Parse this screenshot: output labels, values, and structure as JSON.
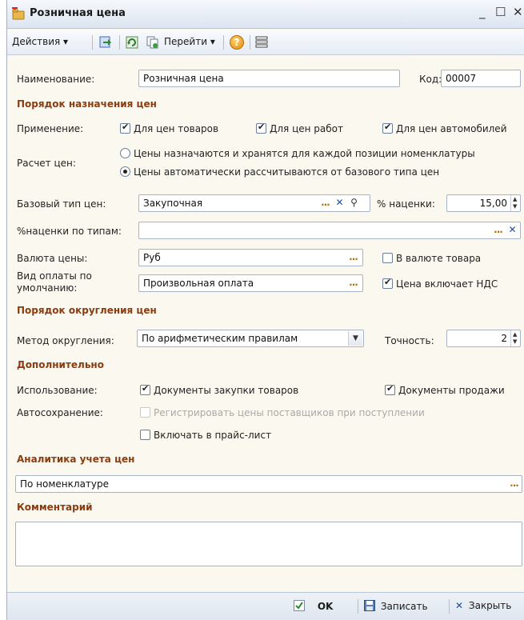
{
  "window": {
    "title": "Розничная цена",
    "minimize": "_",
    "maximize": "☐",
    "close": "✕"
  },
  "toolbar": {
    "actions": "Действия",
    "goto": "Перейти",
    "help": "?"
  },
  "form": {
    "name_label": "Наименование:",
    "name_value": "Розничная цена",
    "code_label": "Код:",
    "code_value": "00007",
    "section_assign": "Порядок назначения цен",
    "apply_label": "Применение:",
    "apply_goods": "Для цен товаров",
    "apply_works": "Для цен работ",
    "apply_cars": "Для цен автомобилей",
    "calc_label": "Расчет цен:",
    "calc_option1": "Цены назначаются и хранятся для каждой позиции номенклатуры",
    "calc_option2": "Цены автоматически рассчитываются от базового типа цен",
    "base_type_label": "Базовый тип цен:",
    "base_type_value": "Закупочная",
    "markup_label": "% наценки:",
    "markup_value": "15,00",
    "markup_by_types_label": "%наценки по типам:",
    "markup_by_types_value": "",
    "currency_label": "Валюта цены:",
    "currency_value": "Руб",
    "in_goods_currency": "В валюте товара",
    "payment_label_1": "Вид оплаты по",
    "payment_label_2": "умолчанию:",
    "payment_value": "Произвольная оплата",
    "includes_vat": "Цена включает НДС",
    "section_rounding": "Порядок округления цен",
    "rounding_method_label": "Метод округления:",
    "rounding_method_value": "По арифметическим правилам",
    "precision_label": "Точность:",
    "precision_value": "2",
    "section_extra": "Дополнительно",
    "usage_label": "Использование:",
    "usage_purchase": "Документы закупки товаров",
    "usage_sales": "Документы продажи",
    "autosave_label": "Автосохранение:",
    "autosave_register": "Регистрировать цены поставщиков при поступлении",
    "include_pricelist": "Включать в прайс-лист",
    "section_analytics": "Аналитика учета цен",
    "analytics_value": "По номенклатуре",
    "section_comment": "Комментарий",
    "comment_value": ""
  },
  "footer": {
    "ok": "OK",
    "save": "Записать",
    "close": "Закрыть"
  },
  "colors": {
    "section": "#8a3c10",
    "background": "#fbf9ef",
    "accent": "#1f4f9a"
  }
}
